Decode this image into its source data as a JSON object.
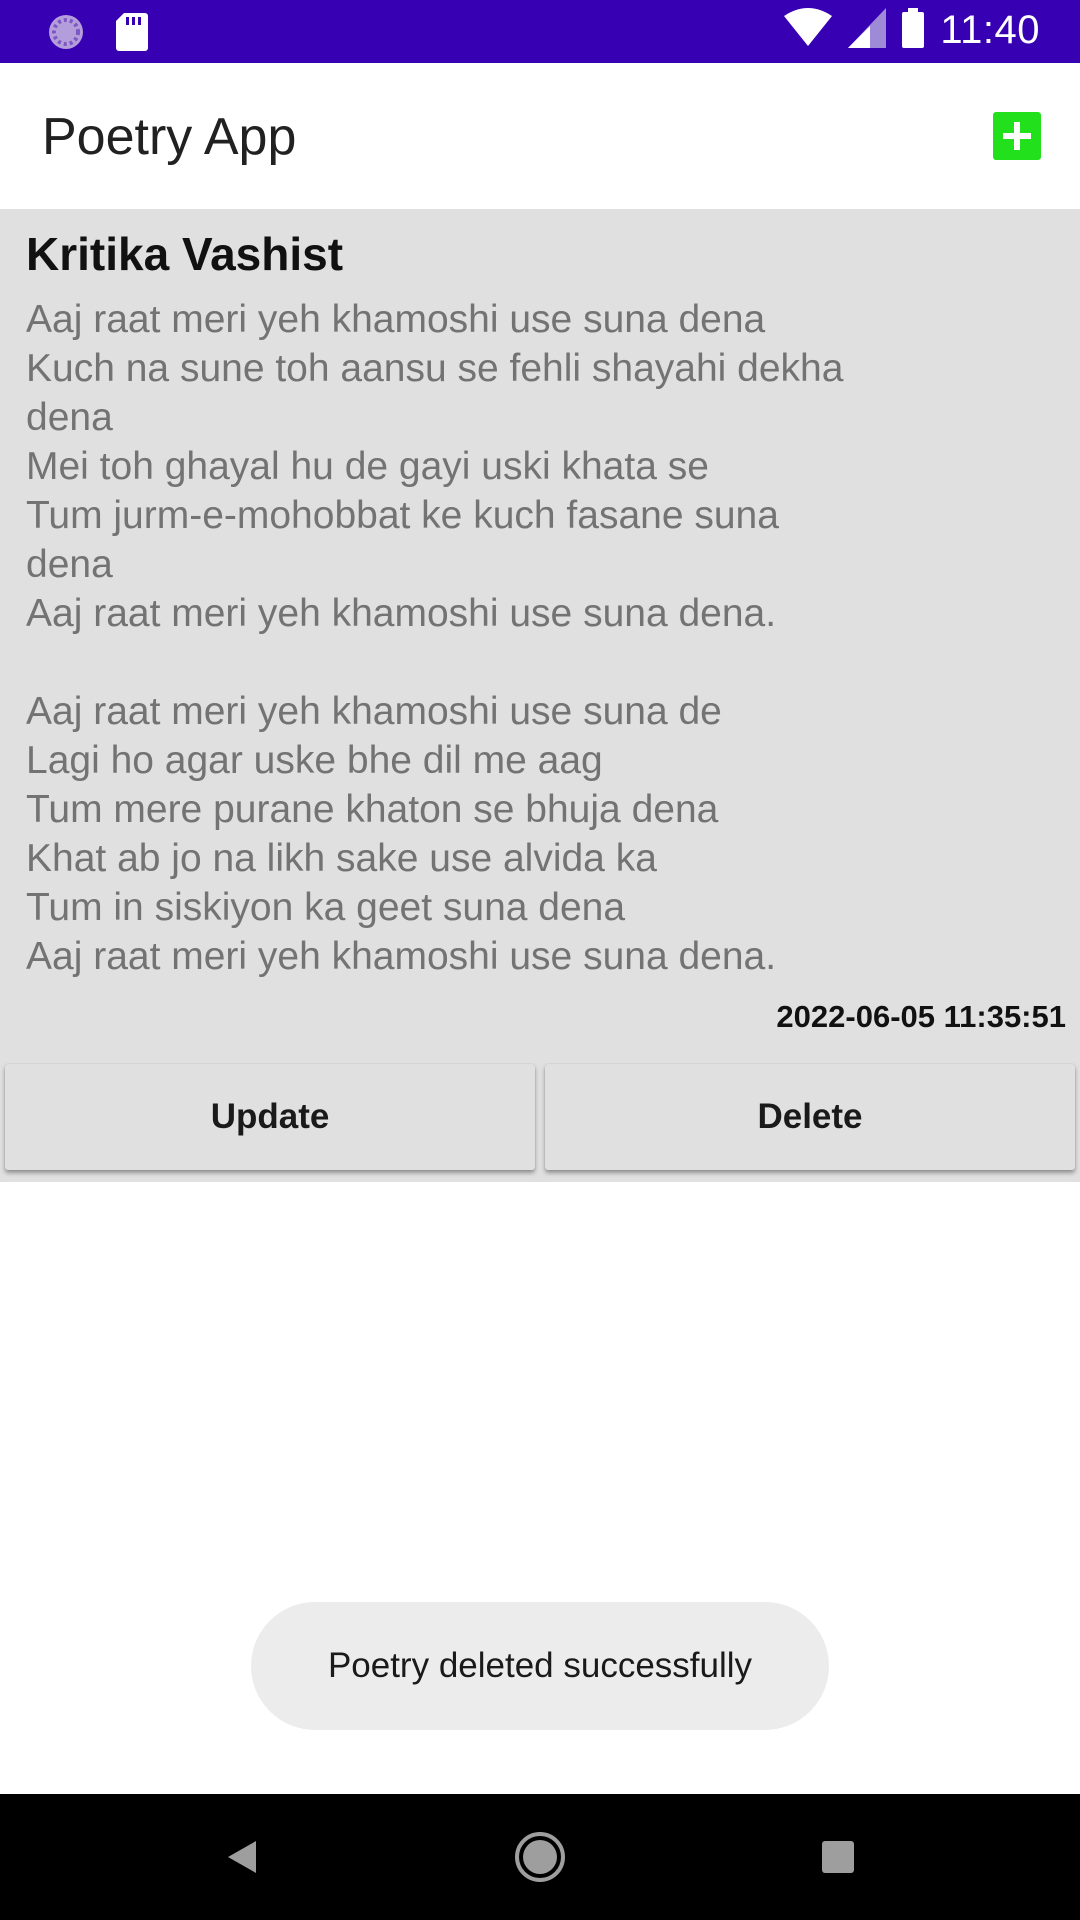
{
  "status_bar": {
    "time": "11:40",
    "left_icons": [
      "loading-indicator-icon",
      "sd-card-icon"
    ],
    "right_icons": [
      "wifi-icon",
      "cellular-signal-icon",
      "battery-icon"
    ],
    "background_color": "#3700b3"
  },
  "app_bar": {
    "title": "Poetry App",
    "add_icon": "add-box-icon",
    "add_icon_color": "#22e01c"
  },
  "poem_card": {
    "poet_name": "Kritika Vashist",
    "poem": "Aaj raat meri yeh khamoshi use suna dena\nKuch na sune toh aansu se fehli shayahi dekha\ndena\nMei toh ghayal hu de gayi uski khata se\nTum jurm-e-mohobbat ke kuch fasane suna\ndena\nAaj raat meri yeh khamoshi use suna dena.\n\nAaj raat meri yeh khamoshi use suna de\nLagi ho agar uske bhe dil me aag\nTum mere purane khaton se bhuja dena\nKhat ab jo na likh sake use alvida ka\nTum in siskiyon ka geet suna dena\nAaj raat meri yeh khamoshi use suna dena.",
    "timestamp": "2022-06-05 11:35:51",
    "update_label": "Update",
    "delete_label": "Delete",
    "background_color": "#e0e0e0"
  },
  "toast": {
    "message": "Poetry deleted successfully"
  },
  "nav_bar": {
    "icons": [
      "back-icon",
      "home-icon",
      "recents-icon"
    ]
  }
}
